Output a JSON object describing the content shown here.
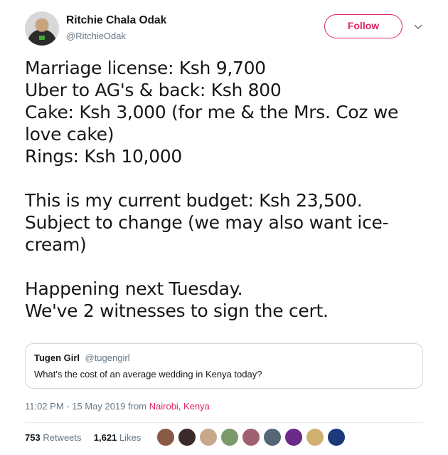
{
  "user": {
    "display_name": "Ritchie Chala Odak",
    "handle": "@RitchieOdak",
    "follow_label": "Follow"
  },
  "tweet": {
    "text": "Marriage license: Ksh 9,700\nUber to AG's & back: Ksh 800\nCake: Ksh 3,000 (for me & the Mrs. Coz we love cake)\nRings: Ksh 10,000\n\nThis is my current budget: Ksh 23,500. Subject to change (we may also want ice-cream)\n\nHappening next Tuesday.\nWe've 2 witnesses to sign the cert."
  },
  "quoted_tweet": {
    "name": "Tugen Girl",
    "handle": "@tugengirl",
    "text": "What's the cost of an average wedding in Kenya today?"
  },
  "meta": {
    "time_date": "11:02 PM - 15 May 2019 from ",
    "location": "Nairobi, Kenya"
  },
  "stats": {
    "retweets_count": "753",
    "retweets_label": "Retweets",
    "likes_count": "1,621",
    "likes_label": "Likes"
  },
  "likers": [
    {
      "color": "#8a5a44"
    },
    {
      "color": "#3a2a2a"
    },
    {
      "color": "#c8a88a"
    },
    {
      "color": "#7a9a6a"
    },
    {
      "color": "#a06070"
    },
    {
      "color": "#556677"
    },
    {
      "color": "#6a2a8a"
    },
    {
      "color": "#d0b070"
    },
    {
      "color": "#1a3a7a"
    }
  ],
  "colors": {
    "accent": "#e0245e",
    "secondary_text": "#657786",
    "border": "#ccd6dd"
  }
}
